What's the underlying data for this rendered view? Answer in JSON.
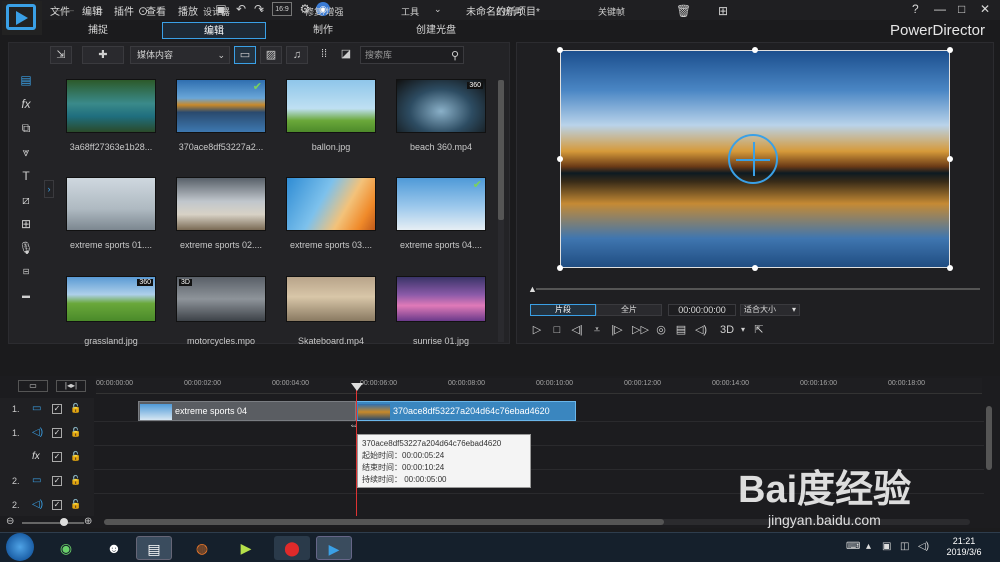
{
  "menu": [
    "文件",
    "编辑",
    "插件",
    "查看",
    "播放"
  ],
  "window_title": "未命名的新项目*",
  "brand": "PowerDirector",
  "window_controls": [
    "?",
    "—",
    "□",
    "✕"
  ],
  "mode_tabs": [
    "捕捉",
    "编辑",
    "制作",
    "创建光盘"
  ],
  "active_mode": "编辑",
  "library": {
    "content_select": "媒体内容",
    "search_placeholder": "搜索库",
    "items": [
      {
        "label": "3a68ff27363e1b28...",
        "badge": "",
        "check": false
      },
      {
        "label": "370ace8df53227a2...",
        "badge": "",
        "check": true
      },
      {
        "label": "ballon.jpg",
        "badge": "",
        "check": false
      },
      {
        "label": "beach 360.mp4",
        "badge": "360",
        "check": false
      },
      {
        "label": "extreme sports 01....",
        "badge": "",
        "check": false
      },
      {
        "label": "extreme sports 02....",
        "badge": "",
        "check": false
      },
      {
        "label": "extreme sports 03....",
        "badge": "",
        "check": false
      },
      {
        "label": "extreme sports 04....",
        "badge": "",
        "check": true
      },
      {
        "label": "grassland.jpg",
        "badge": "360",
        "check": false
      },
      {
        "label": "motorcycles.mpo",
        "badge": "3D",
        "check": false
      },
      {
        "label": "Skateboard.mp4",
        "badge": "",
        "check": false
      },
      {
        "label": "sunrise 01.jpg",
        "badge": "",
        "check": false
      }
    ]
  },
  "preview": {
    "clip_label": "片段",
    "full_label": "全片",
    "timecode": "00:00:00:00",
    "fit_label": "适合大小",
    "three_d_label": "3D"
  },
  "timeline_toolbar": {
    "designer": "设计器",
    "fix_enhance": "修复/增强",
    "tools": "工具",
    "slideshow": "幻灯片",
    "keyframe": "关键帧"
  },
  "ruler": [
    "00:00:00:00",
    "00:00:02:00",
    "00:00:04:00",
    "00:00:06:00",
    "00:00:08:00",
    "00:00:10:00",
    "00:00:12:00",
    "00:00:14:00",
    "00:00:16:00",
    "00:00:18:00"
  ],
  "tracks": [
    {
      "num": "1.",
      "type": "video"
    },
    {
      "num": "1.",
      "type": "audio"
    },
    {
      "num": "",
      "type": "fx"
    },
    {
      "num": "2.",
      "type": "video"
    },
    {
      "num": "2.",
      "type": "audio"
    }
  ],
  "clips": [
    {
      "label": "extreme sports 04"
    },
    {
      "label": "370ace8df53227a204d64c76ebad4620"
    }
  ],
  "tooltip": {
    "title": "370ace8df53227a204d64c76ebad4620",
    "start": "起始时间：00:00:05:24",
    "end": "结束时间：00:00:10:24",
    "duration": "持续时间：  00:00:05:00"
  },
  "taskbar": {
    "time": "21:21",
    "date": "2019/3/6"
  },
  "watermark": {
    "logo": "Bai度经验",
    "url": "jingyan.baidu.com"
  }
}
